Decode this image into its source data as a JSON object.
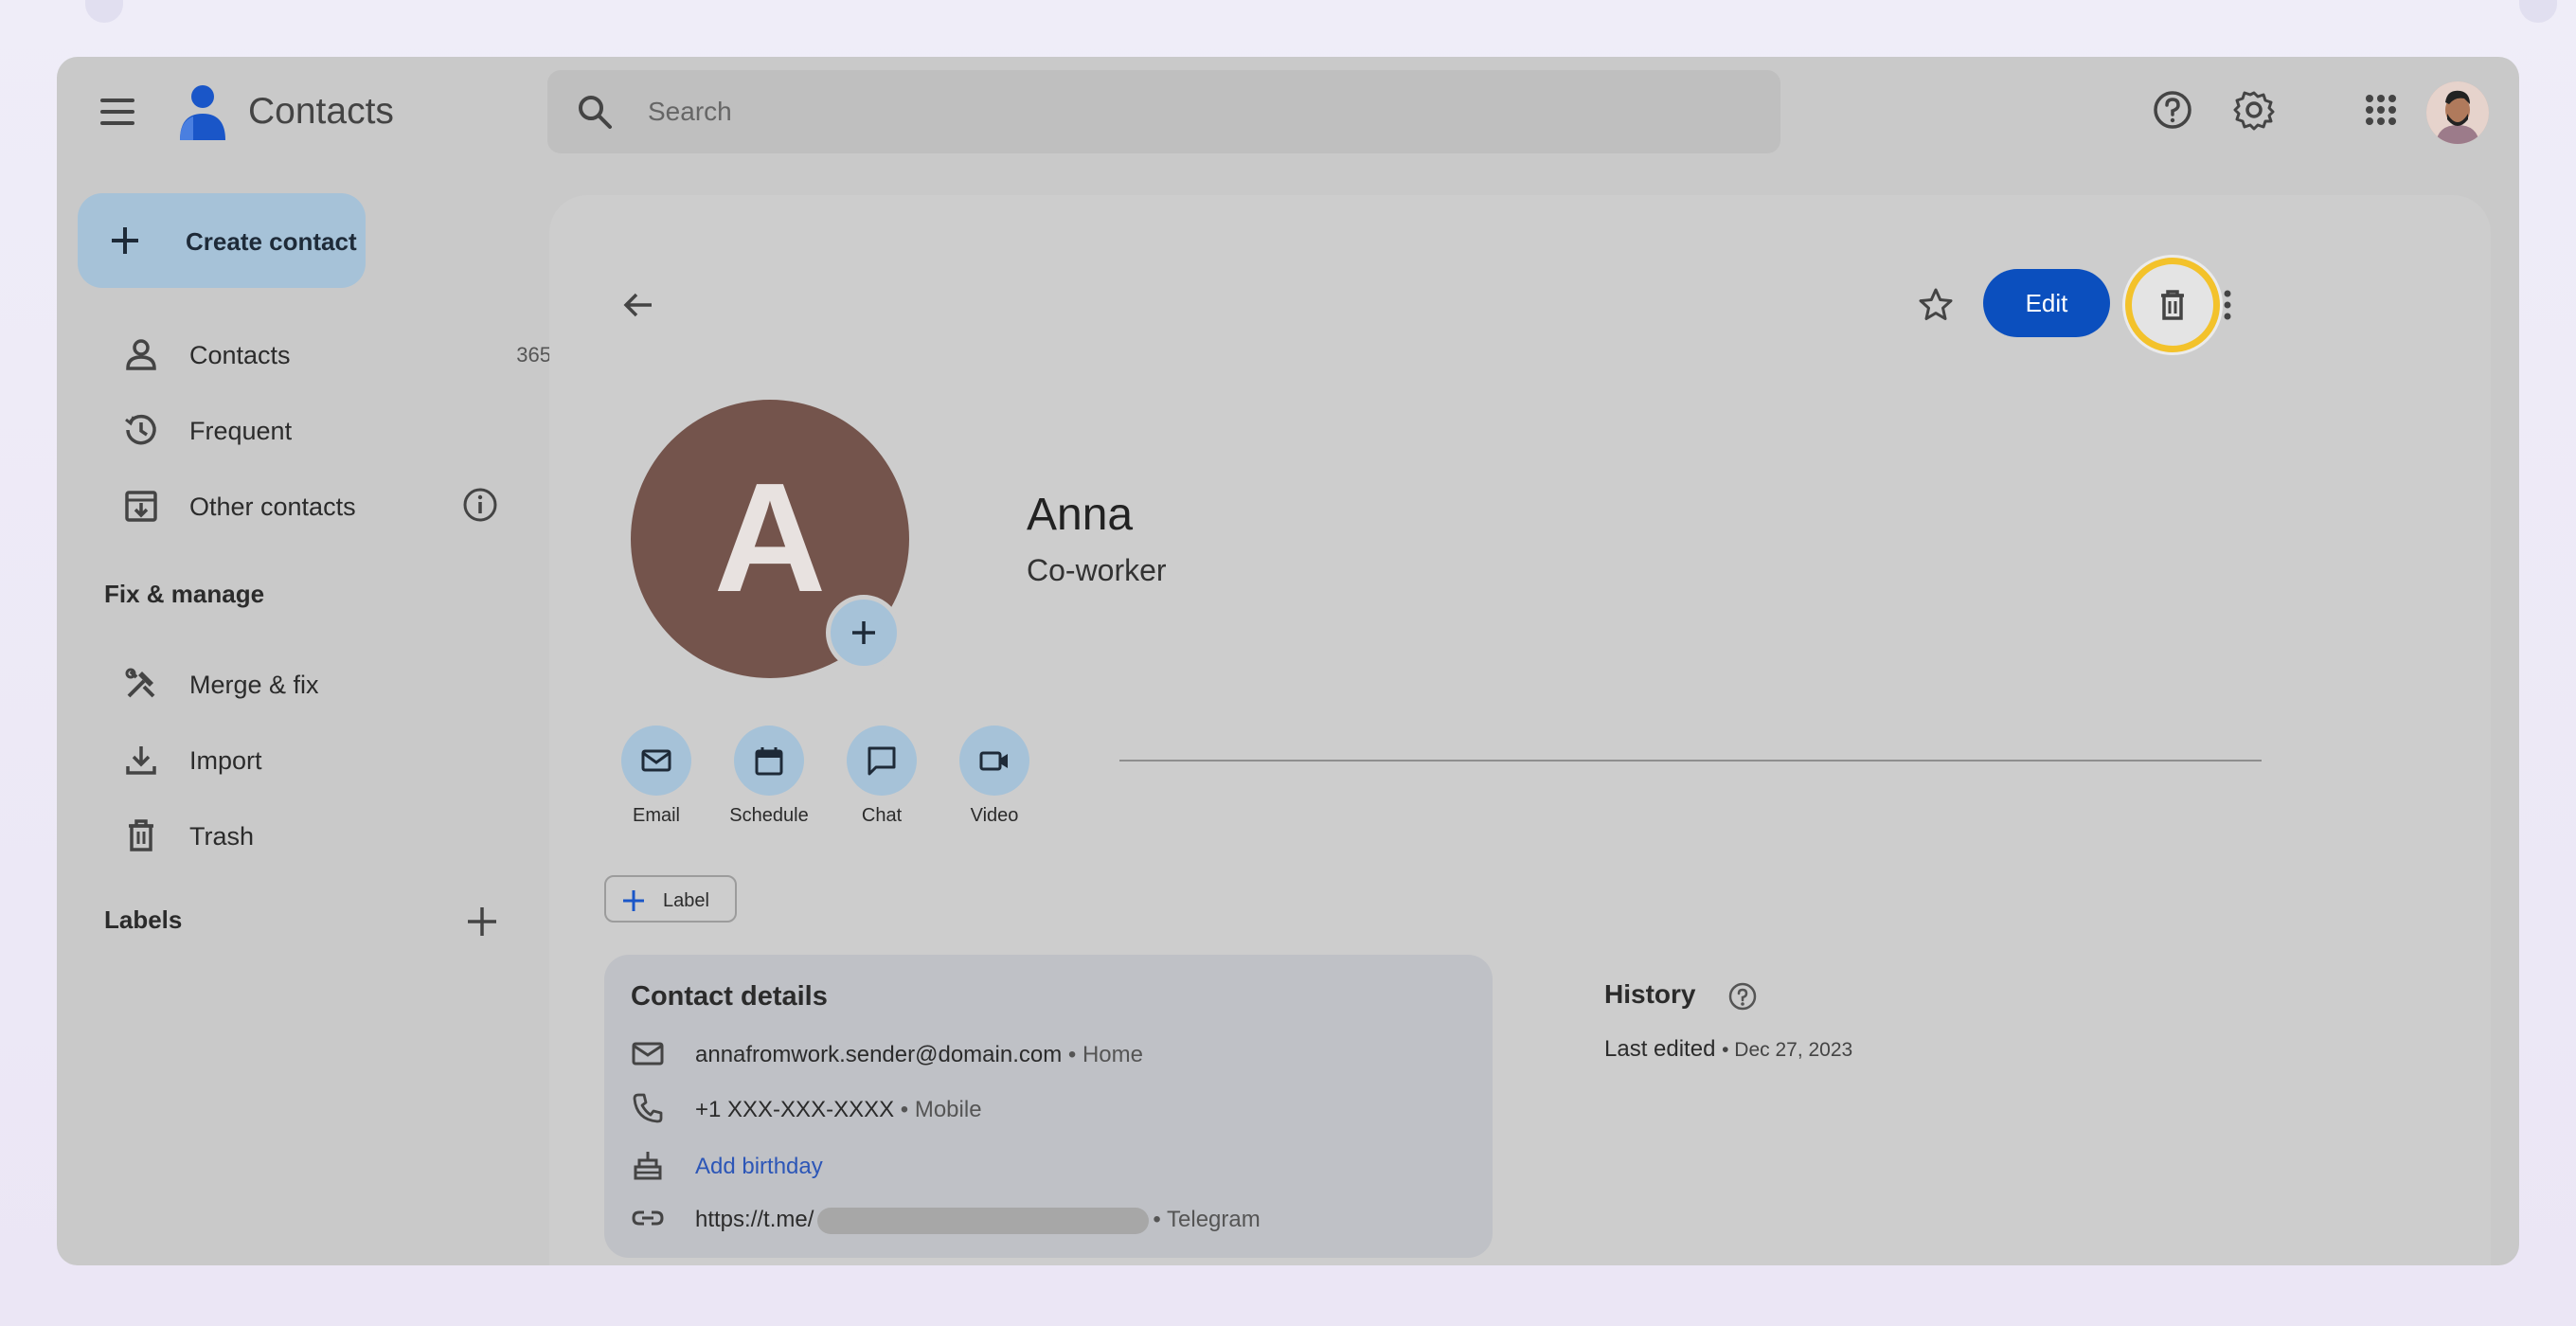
{
  "app": {
    "title": "Contacts"
  },
  "search": {
    "placeholder": "Search"
  },
  "sidebar": {
    "create_label": "Create contact",
    "items": [
      {
        "label": "Contacts",
        "count": "365",
        "icon": "person-icon"
      },
      {
        "label": "Frequent",
        "icon": "history-icon"
      },
      {
        "label": "Other contacts",
        "icon": "archive-download-icon"
      }
    ],
    "fix_manage_heading": "Fix & manage",
    "fix_items": [
      {
        "label": "Merge & fix",
        "icon": "tools-icon"
      },
      {
        "label": "Import",
        "icon": "download-icon"
      },
      {
        "label": "Trash",
        "icon": "trash-icon"
      }
    ],
    "labels_heading": "Labels"
  },
  "contact": {
    "initial": "A",
    "name": "Anna",
    "subtitle": "Co-worker",
    "edit_label": "Edit",
    "actions": [
      {
        "label": "Email",
        "icon": "email-icon"
      },
      {
        "label": "Schedule",
        "icon": "calendar-icon"
      },
      {
        "label": "Chat",
        "icon": "chat-icon"
      },
      {
        "label": "Video",
        "icon": "video-icon"
      }
    ],
    "label_chip": "Label",
    "details_heading": "Contact details",
    "email": "annafromwork.sender@domain.com",
    "email_type": "• Home",
    "phone": "+1 XXX-XXX-XXXX",
    "phone_type": "• Mobile",
    "birthday_link": "Add birthday",
    "url_prefix": "https://t.me/",
    "url_type": "• Telegram",
    "history_heading": "History",
    "last_edited_label": "Last edited",
    "last_edited_date": "• Dec 27, 2023"
  },
  "colors": {
    "accent_blue": "#0b4fbe",
    "highlight_ring": "#f3c22b",
    "avatar_bg": "#74544c"
  }
}
